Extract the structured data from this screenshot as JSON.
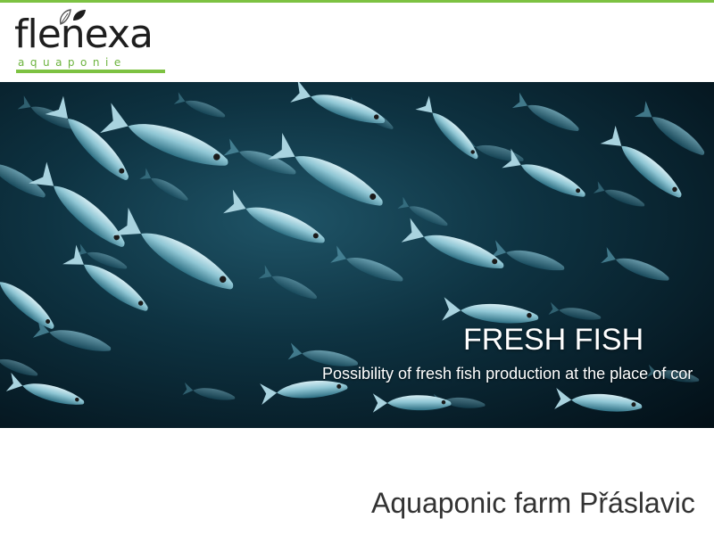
{
  "colors": {
    "accent": "#7dc242",
    "hero_bg": "#0e3342",
    "heading_text": "#333333"
  },
  "header": {
    "logo": {
      "name": "flenexa",
      "tagline": "aquaponie",
      "icon": "leaf-icon"
    }
  },
  "hero": {
    "title": "FRESH FISH",
    "subtitle": "Possibility of fresh fish production at the place of cor",
    "image": "school-of-fish-photo"
  },
  "main": {
    "heading": "Aquaponic farm Přáslavic"
  }
}
